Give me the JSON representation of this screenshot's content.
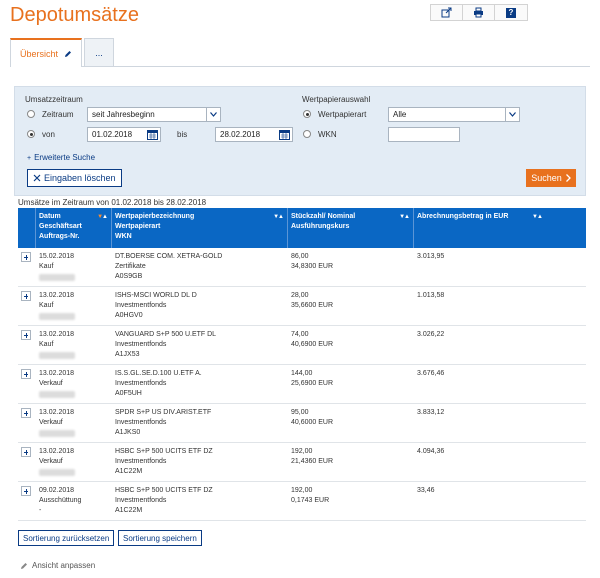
{
  "page": {
    "title": "Depotumsätze"
  },
  "toolbar": {
    "icons": [
      "export-icon",
      "print-icon",
      "help-icon"
    ],
    "help_label": "?"
  },
  "tabs": [
    {
      "label": "Übersicht",
      "active": true
    },
    {
      "label": "...",
      "active": false
    }
  ],
  "filter": {
    "period_heading": "Umsatzzeitraum",
    "zeitraum_label": "Zeitraum",
    "zeitraum_value": "seit Jahresbeginn",
    "von_label": "von",
    "von_value": "01.02.2018",
    "bis_label": "bis",
    "bis_value": "28.02.2018",
    "security_heading": "Wertpapierauswahl",
    "wertpapierart_label": "Wertpapierart",
    "wertpapierart_value": "Alle",
    "wkn_label": "WKN",
    "wkn_value": "",
    "extended_search": "Erweiterte Suche",
    "clear_label": "Eingaben löschen",
    "search_label": "Suchen"
  },
  "period_text": "Umsätze im Zeitraum von 01.02.2018 bis 28.02.2018",
  "table": {
    "headers": [
      [
        "Datum",
        "Geschäftsart",
        "Auftrags-Nr."
      ],
      [
        "Wertpapierbezeichnung",
        "Wertpapierart",
        "WKN"
      ],
      [
        "Stückzahl/ Nominal",
        "Ausführungskurs"
      ],
      [
        "Abrechnungsbetrag in EUR"
      ]
    ],
    "rows": [
      {
        "date": "15.02.2018",
        "type": "Kauf",
        "name": "DT.BOERSE COM. XETRA-GOLD",
        "kind": "Zertifikate",
        "wkn": "A0S9GB",
        "qty": "86,00",
        "price": "34,8300 EUR",
        "amount": "3.013,95"
      },
      {
        "date": "13.02.2018",
        "type": "Kauf",
        "name": "ISHS-MSCI WORLD DL D",
        "kind": "Investmentfonds",
        "wkn": "A0HGV0",
        "qty": "28,00",
        "price": "35,6600 EUR",
        "amount": "1.013,58"
      },
      {
        "date": "13.02.2018",
        "type": "Kauf",
        "name": "VANGUARD S+P 500 U.ETF DL",
        "kind": "Investmentfonds",
        "wkn": "A1JX53",
        "qty": "74,00",
        "price": "40,6900 EUR",
        "amount": "3.026,22"
      },
      {
        "date": "13.02.2018",
        "type": "Verkauf",
        "name": "IS.S.GL.SE.D.100 U.ETF A.",
        "kind": "Investmentfonds",
        "wkn": "A0F5UH",
        "qty": "144,00",
        "price": "25,6900 EUR",
        "amount": "3.676,46"
      },
      {
        "date": "13.02.2018",
        "type": "Verkauf",
        "name": "SPDR S+P US DIV.ARIST.ETF",
        "kind": "Investmentfonds",
        "wkn": "A1JKS0",
        "qty": "95,00",
        "price": "40,6000 EUR",
        "amount": "3.833,12"
      },
      {
        "date": "13.02.2018",
        "type": "Verkauf",
        "name": "HSBC S+P 500 UCITS ETF DZ",
        "kind": "Investmentfonds",
        "wkn": "A1C22M",
        "qty": "192,00",
        "price": "21,4360 EUR",
        "amount": "4.094,36"
      },
      {
        "date": "09.02.2018",
        "type": "Ausschüttung",
        "order": "-",
        "name": "HSBC S+P 500 UCITS ETF DZ",
        "kind": "Investmentfonds",
        "wkn": "A1C22M",
        "qty": "192,00",
        "price": "0,1743 EUR",
        "amount": "33,46"
      }
    ]
  },
  "footer": {
    "reset_sort": "Sortierung zurücksetzen",
    "save_sort": "Sortierung speichern",
    "adjust_view": "Ansicht anpassen"
  },
  "colors": {
    "accent": "#e8711e",
    "header": "#0a67c4",
    "navy": "#0a3b84",
    "filter_bg": "#e3ecf5"
  }
}
